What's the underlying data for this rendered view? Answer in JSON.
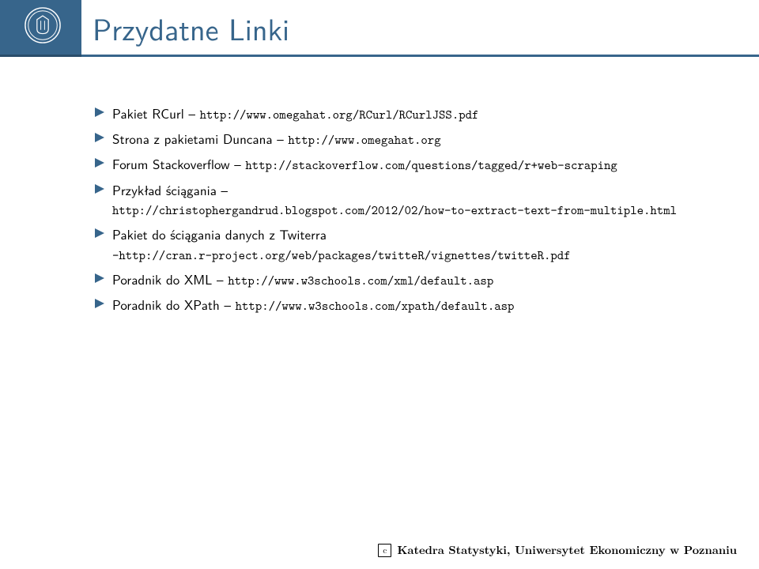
{
  "header": {
    "title": "Przydatne Linki"
  },
  "items": [
    {
      "label_pre": "Pakiet RCurl – ",
      "url": "http://www.omegahat.org/RCurl/RCurlJSS.pdf"
    },
    {
      "label_pre": "Strona z pakietami Duncana – ",
      "url": "http://www.omegahat.org"
    },
    {
      "label_pre": "Forum Stackoverflow – ",
      "url": "http://stackoverflow.com/questions/tagged/r+web-scraping"
    },
    {
      "label_pre": "Przykład ściągania – ",
      "url": "http://christophergandrud.blogspot.com/2012/02/how-to-extract-text-from-multiple.html"
    },
    {
      "label_pre": "Pakiet do ściągania danych z Twiterra",
      "url": "–http://cran.r-project.org/web/packages/twitteR/vignettes/twitteR.pdf"
    },
    {
      "label_pre": "Poradnik do XML – ",
      "url": "http://www.w3schools.com/xml/default.asp"
    },
    {
      "label_pre": "Poradnik do XPath – ",
      "url": "http://www.w3schools.com/xpath/default.asp"
    }
  ],
  "footer": {
    "copyright_symbol": "c",
    "text": "Katedra Statystyki, Uniwersytet Ekonomiczny w Poznaniu"
  }
}
